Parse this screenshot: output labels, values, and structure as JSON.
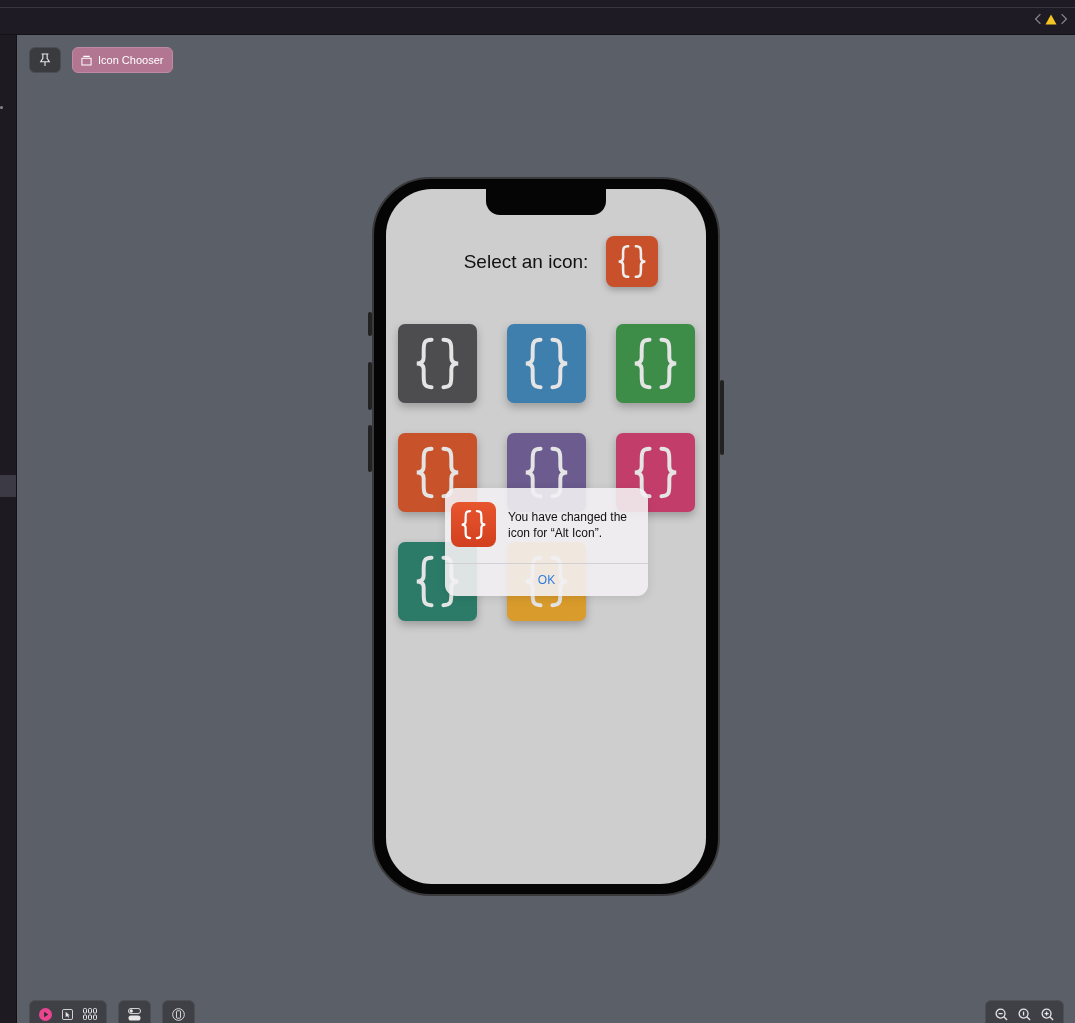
{
  "scheme": {
    "name": "Icon Chooser"
  },
  "screen": {
    "prompt": "Select an icon:",
    "current_icon": {
      "color": "#c8502a"
    },
    "icons": [
      {
        "color": "#4d4d50"
      },
      {
        "color": "#3f7fae"
      },
      {
        "color": "#3d8d48"
      },
      {
        "color": "#c8532b"
      },
      {
        "color": "#6b5b8e"
      },
      {
        "color": "#c33d6b"
      },
      {
        "color": "#2c7b69"
      },
      {
        "color": "#d99b2b"
      }
    ]
  },
  "alert": {
    "message": "You have changed the icon for “Alt Icon”.",
    "buttons": [
      "OK"
    ]
  }
}
